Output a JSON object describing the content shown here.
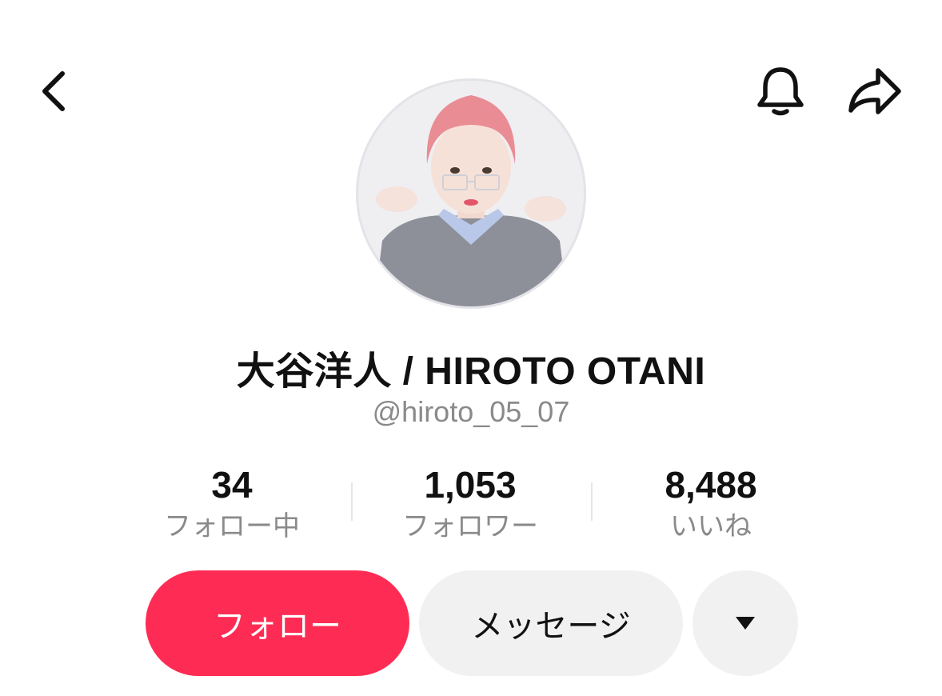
{
  "header": {
    "back_icon": "chevron-left-icon",
    "notification_icon": "bell-icon",
    "share_icon": "share-arrow-icon"
  },
  "profile": {
    "display_name": "大谷洋人 / HIROTO OTANI",
    "username": "@hiroto_05_07"
  },
  "stats": {
    "following": {
      "value": "34",
      "label": "フォロー中"
    },
    "followers": {
      "value": "1,053",
      "label": "フォロワー"
    },
    "likes": {
      "value": "8,488",
      "label": "いいね"
    }
  },
  "actions": {
    "follow_label": "フォロー",
    "message_label": "メッセージ",
    "more_icon": "caret-down-icon"
  },
  "colors": {
    "accent": "#fe2c55",
    "secondary_button": "#f1f1f2",
    "muted_text": "#8a8a8a"
  }
}
